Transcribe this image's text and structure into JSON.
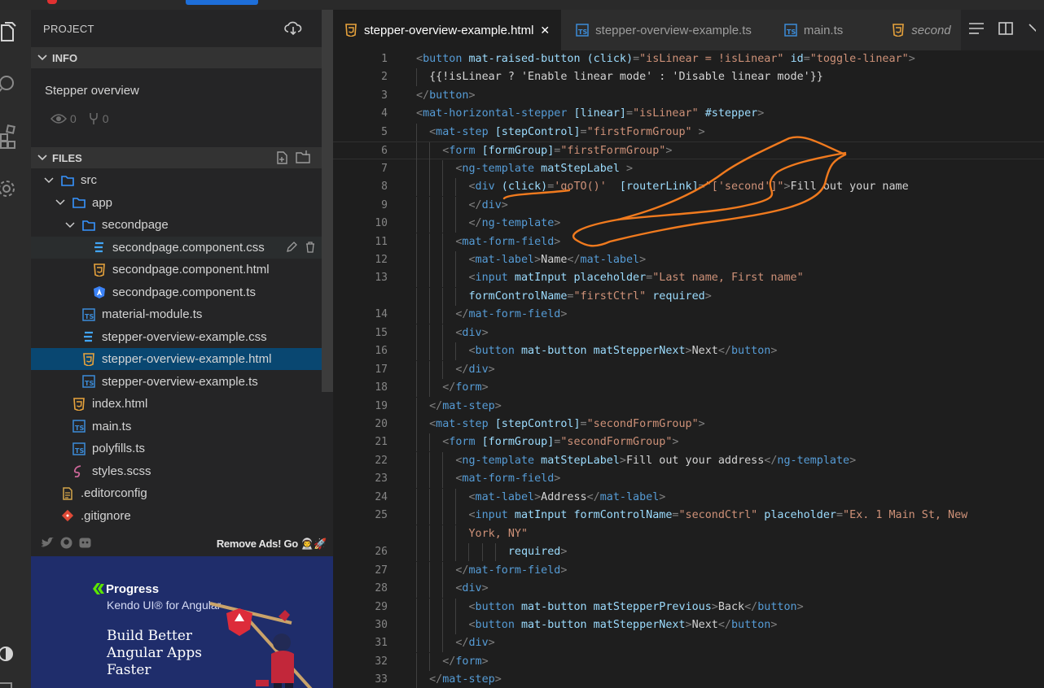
{
  "sidebar": {
    "project_label": "PROJECT",
    "info_label": "INFO",
    "project_title": "Stepper overview",
    "views": "0",
    "forks": "0",
    "files_label": "FILES",
    "tree": [
      {
        "label": "src",
        "type": "folder",
        "depth": 1,
        "expanded": true
      },
      {
        "label": "app",
        "type": "folder",
        "depth": 2,
        "expanded": true
      },
      {
        "label": "secondpage",
        "type": "folder",
        "depth": 3,
        "expanded": true
      },
      {
        "label": "secondpage.component.css",
        "type": "css",
        "depth": 4
      },
      {
        "label": "secondpage.component.html",
        "type": "html",
        "depth": 4
      },
      {
        "label": "secondpage.component.ts",
        "type": "angular",
        "depth": 4
      },
      {
        "label": "material-module.ts",
        "type": "ts",
        "depth": 3
      },
      {
        "label": "stepper-overview-example.css",
        "type": "css",
        "depth": 3
      },
      {
        "label": "stepper-overview-example.html",
        "type": "html",
        "depth": 3,
        "selected": true
      },
      {
        "label": "stepper-overview-example.ts",
        "type": "ts",
        "depth": 3
      },
      {
        "label": "index.html",
        "type": "html",
        "depth": 2
      },
      {
        "label": "main.ts",
        "type": "ts",
        "depth": 2
      },
      {
        "label": "polyfills.ts",
        "type": "ts",
        "depth": 2
      },
      {
        "label": "styles.scss",
        "type": "scss",
        "depth": 2
      },
      {
        "label": ".editorconfig",
        "type": "config",
        "depth": 1
      },
      {
        "label": ".gitignore",
        "type": "git",
        "depth": 1
      }
    ],
    "ads_text": "Remove Ads! Go 👨‍🚀🚀",
    "ad": {
      "brand": "Progress",
      "product": "Kendo UI® for Angular",
      "tagline": "Build Better Angular Apps Faster"
    }
  },
  "tabs": [
    {
      "label": "stepper-overview-example.html",
      "icon": "html-icon",
      "active": true
    },
    {
      "label": "stepper-overview-example.ts",
      "icon": "ts-icon"
    },
    {
      "label": "main.ts",
      "icon": "ts-icon"
    },
    {
      "label": "second",
      "icon": "html-icon",
      "italic": true
    }
  ],
  "colors": {
    "tag": "#569cd6",
    "attribute": "#9cdcfe",
    "string": "#ce9178",
    "selection": "#094771",
    "annotation": "#f07a1e"
  },
  "code": {
    "lines": [
      {
        "n": "1",
        "indent": 0,
        "tokens": [
          [
            "p",
            "<"
          ],
          [
            "t",
            "button"
          ],
          [
            "x",
            " "
          ],
          [
            "a",
            "mat-raised-button"
          ],
          [
            "x",
            " "
          ],
          [
            "a",
            "(click)"
          ],
          [
            "p",
            "="
          ],
          [
            "s",
            "\"isLinear = !isLinear\""
          ],
          [
            "x",
            " "
          ],
          [
            "a",
            "id"
          ],
          [
            "p",
            "="
          ],
          [
            "s",
            "\"toggle-linear\""
          ],
          [
            "p",
            ">"
          ]
        ]
      },
      {
        "n": "2",
        "indent": 1,
        "tokens": [
          [
            "x",
            "{{!isLinear ? 'Enable linear mode' : 'Disable linear mode'}}"
          ]
        ]
      },
      {
        "n": "3",
        "indent": 0,
        "tokens": [
          [
            "p",
            "</"
          ],
          [
            "t",
            "button"
          ],
          [
            "p",
            ">"
          ]
        ]
      },
      {
        "n": "4",
        "indent": 0,
        "tokens": [
          [
            "p",
            "<"
          ],
          [
            "t",
            "mat-horizontal-stepper"
          ],
          [
            "x",
            " "
          ],
          [
            "a",
            "[linear]"
          ],
          [
            "p",
            "="
          ],
          [
            "s",
            "\"isLinear\""
          ],
          [
            "x",
            " "
          ],
          [
            "a",
            "#stepper"
          ],
          [
            "p",
            ">"
          ]
        ]
      },
      {
        "n": "5",
        "indent": 1,
        "tokens": [
          [
            "p",
            "<"
          ],
          [
            "t",
            "mat-step"
          ],
          [
            "x",
            " "
          ],
          [
            "a",
            "[stepControl]"
          ],
          [
            "p",
            "="
          ],
          [
            "s",
            "\"firstFormGroup\""
          ],
          [
            "x",
            " "
          ],
          [
            "p",
            ">"
          ]
        ]
      },
      {
        "n": "6",
        "indent": 2,
        "current": true,
        "tokens": [
          [
            "p",
            "<"
          ],
          [
            "t",
            "form"
          ],
          [
            "x",
            " "
          ],
          [
            "a",
            "[formGroup]"
          ],
          [
            "p",
            "="
          ],
          [
            "s",
            "\"firstFormGroup\""
          ],
          [
            "p",
            ">"
          ]
        ]
      },
      {
        "n": "7",
        "indent": 3,
        "tokens": [
          [
            "p",
            "<"
          ],
          [
            "t",
            "ng-template"
          ],
          [
            "x",
            " "
          ],
          [
            "a",
            "matStepLabel"
          ],
          [
            "x",
            " "
          ],
          [
            "p",
            ">"
          ]
        ]
      },
      {
        "n": "8",
        "indent": 4,
        "tokens": [
          [
            "p",
            "<"
          ],
          [
            "t",
            "div"
          ],
          [
            "x",
            " "
          ],
          [
            "a",
            "(click)"
          ],
          [
            "p",
            "="
          ],
          [
            "s",
            "'goTO()'"
          ],
          [
            "x",
            "  "
          ],
          [
            "a",
            "[routerLink]"
          ],
          [
            "p",
            "="
          ],
          [
            "s",
            "\"['second']\""
          ],
          [
            "p",
            ">"
          ],
          [
            "x",
            "Fill out your name"
          ]
        ]
      },
      {
        "n": "9",
        "indent": 4,
        "tokens": [
          [
            "p",
            "</"
          ],
          [
            "t",
            "div"
          ],
          [
            "p",
            ">"
          ]
        ]
      },
      {
        "n": "10",
        "indent": 4,
        "tokens": [
          [
            "p",
            "</"
          ],
          [
            "t",
            "ng-template"
          ],
          [
            "p",
            ">"
          ]
        ]
      },
      {
        "n": "11",
        "indent": 3,
        "tokens": [
          [
            "p",
            "<"
          ],
          [
            "t",
            "mat-form-field"
          ],
          [
            "p",
            ">"
          ]
        ]
      },
      {
        "n": "12",
        "indent": 4,
        "tokens": [
          [
            "p",
            "<"
          ],
          [
            "t",
            "mat-label"
          ],
          [
            "p",
            ">"
          ],
          [
            "x",
            "Name"
          ],
          [
            "p",
            "</"
          ],
          [
            "t",
            "mat-label"
          ],
          [
            "p",
            ">"
          ]
        ]
      },
      {
        "n": "13",
        "indent": 4,
        "tokens": [
          [
            "p",
            "<"
          ],
          [
            "t",
            "input"
          ],
          [
            "x",
            " "
          ],
          [
            "a",
            "matInput"
          ],
          [
            "x",
            " "
          ],
          [
            "a",
            "placeholder"
          ],
          [
            "p",
            "="
          ],
          [
            "s",
            "\"Last name, First name\""
          ]
        ]
      },
      {
        "n": "",
        "indent": 4,
        "tokens": [
          [
            "a",
            "formControlName"
          ],
          [
            "p",
            "="
          ],
          [
            "s",
            "\"firstCtrl\""
          ],
          [
            "x",
            " "
          ],
          [
            "a",
            "required"
          ],
          [
            "p",
            ">"
          ]
        ]
      },
      {
        "n": "14",
        "indent": 3,
        "tokens": [
          [
            "p",
            "</"
          ],
          [
            "t",
            "mat-form-field"
          ],
          [
            "p",
            ">"
          ]
        ]
      },
      {
        "n": "15",
        "indent": 3,
        "tokens": [
          [
            "p",
            "<"
          ],
          [
            "t",
            "div"
          ],
          [
            "p",
            ">"
          ]
        ]
      },
      {
        "n": "16",
        "indent": 4,
        "tokens": [
          [
            "p",
            "<"
          ],
          [
            "t",
            "button"
          ],
          [
            "x",
            " "
          ],
          [
            "a",
            "mat-button"
          ],
          [
            "x",
            " "
          ],
          [
            "a",
            "matStepperNext"
          ],
          [
            "p",
            ">"
          ],
          [
            "x",
            "Next"
          ],
          [
            "p",
            "</"
          ],
          [
            "t",
            "button"
          ],
          [
            "p",
            ">"
          ]
        ]
      },
      {
        "n": "17",
        "indent": 3,
        "tokens": [
          [
            "p",
            "</"
          ],
          [
            "t",
            "div"
          ],
          [
            "p",
            ">"
          ]
        ]
      },
      {
        "n": "18",
        "indent": 2,
        "tokens": [
          [
            "p",
            "</"
          ],
          [
            "t",
            "form"
          ],
          [
            "p",
            ">"
          ]
        ]
      },
      {
        "n": "19",
        "indent": 1,
        "tokens": [
          [
            "p",
            "</"
          ],
          [
            "t",
            "mat-step"
          ],
          [
            "p",
            ">"
          ]
        ]
      },
      {
        "n": "20",
        "indent": 1,
        "tokens": [
          [
            "p",
            "<"
          ],
          [
            "t",
            "mat-step"
          ],
          [
            "x",
            " "
          ],
          [
            "a",
            "[stepControl]"
          ],
          [
            "p",
            "="
          ],
          [
            "s",
            "\"secondFormGroup\""
          ],
          [
            "p",
            ">"
          ]
        ]
      },
      {
        "n": "21",
        "indent": 2,
        "tokens": [
          [
            "p",
            "<"
          ],
          [
            "t",
            "form"
          ],
          [
            "x",
            " "
          ],
          [
            "a",
            "[formGroup]"
          ],
          [
            "p",
            "="
          ],
          [
            "s",
            "\"secondFormGroup\""
          ],
          [
            "p",
            ">"
          ]
        ]
      },
      {
        "n": "22",
        "indent": 3,
        "tokens": [
          [
            "p",
            "<"
          ],
          [
            "t",
            "ng-template"
          ],
          [
            "x",
            " "
          ],
          [
            "a",
            "matStepLabel"
          ],
          [
            "p",
            ">"
          ],
          [
            "x",
            "Fill out your address"
          ],
          [
            "p",
            "</"
          ],
          [
            "t",
            "ng-template"
          ],
          [
            "p",
            ">"
          ]
        ]
      },
      {
        "n": "23",
        "indent": 3,
        "tokens": [
          [
            "p",
            "<"
          ],
          [
            "t",
            "mat-form-field"
          ],
          [
            "p",
            ">"
          ]
        ]
      },
      {
        "n": "24",
        "indent": 4,
        "tokens": [
          [
            "p",
            "<"
          ],
          [
            "t",
            "mat-label"
          ],
          [
            "p",
            ">"
          ],
          [
            "x",
            "Address"
          ],
          [
            "p",
            "</"
          ],
          [
            "t",
            "mat-label"
          ],
          [
            "p",
            ">"
          ]
        ]
      },
      {
        "n": "25",
        "indent": 4,
        "tokens": [
          [
            "p",
            "<"
          ],
          [
            "t",
            "input"
          ],
          [
            "x",
            " "
          ],
          [
            "a",
            "matInput"
          ],
          [
            "x",
            " "
          ],
          [
            "a",
            "formControlName"
          ],
          [
            "p",
            "="
          ],
          [
            "s",
            "\"secondCtrl\""
          ],
          [
            "x",
            " "
          ],
          [
            "a",
            "placeholder"
          ],
          [
            "p",
            "="
          ],
          [
            "s",
            "\"Ex. 1 Main St, New"
          ]
        ]
      },
      {
        "n": "",
        "indent": 4,
        "tokens": [
          [
            "s",
            "York, NY\""
          ]
        ]
      },
      {
        "n": "26",
        "indent": 7,
        "tokens": [
          [
            "a",
            "required"
          ],
          [
            "p",
            ">"
          ]
        ]
      },
      {
        "n": "27",
        "indent": 3,
        "tokens": [
          [
            "p",
            "</"
          ],
          [
            "t",
            "mat-form-field"
          ],
          [
            "p",
            ">"
          ]
        ]
      },
      {
        "n": "28",
        "indent": 3,
        "tokens": [
          [
            "p",
            "<"
          ],
          [
            "t",
            "div"
          ],
          [
            "p",
            ">"
          ]
        ]
      },
      {
        "n": "29",
        "indent": 4,
        "tokens": [
          [
            "p",
            "<"
          ],
          [
            "t",
            "button"
          ],
          [
            "x",
            " "
          ],
          [
            "a",
            "mat-button"
          ],
          [
            "x",
            " "
          ],
          [
            "a",
            "matStepperPrevious"
          ],
          [
            "p",
            ">"
          ],
          [
            "x",
            "Back"
          ],
          [
            "p",
            "</"
          ],
          [
            "t",
            "button"
          ],
          [
            "p",
            ">"
          ]
        ]
      },
      {
        "n": "30",
        "indent": 4,
        "tokens": [
          [
            "p",
            "<"
          ],
          [
            "t",
            "button"
          ],
          [
            "x",
            " "
          ],
          [
            "a",
            "mat-button"
          ],
          [
            "x",
            " "
          ],
          [
            "a",
            "matStepperNext"
          ],
          [
            "p",
            ">"
          ],
          [
            "x",
            "Next"
          ],
          [
            "p",
            "</"
          ],
          [
            "t",
            "button"
          ],
          [
            "p",
            ">"
          ]
        ]
      },
      {
        "n": "31",
        "indent": 3,
        "tokens": [
          [
            "p",
            "</"
          ],
          [
            "t",
            "div"
          ],
          [
            "p",
            ">"
          ]
        ]
      },
      {
        "n": "32",
        "indent": 2,
        "tokens": [
          [
            "p",
            "</"
          ],
          [
            "t",
            "form"
          ],
          [
            "p",
            ">"
          ]
        ]
      },
      {
        "n": "33",
        "indent": 1,
        "tokens": [
          [
            "p",
            "</"
          ],
          [
            "t",
            "mat-step"
          ],
          [
            "p",
            ">"
          ]
        ]
      }
    ]
  }
}
